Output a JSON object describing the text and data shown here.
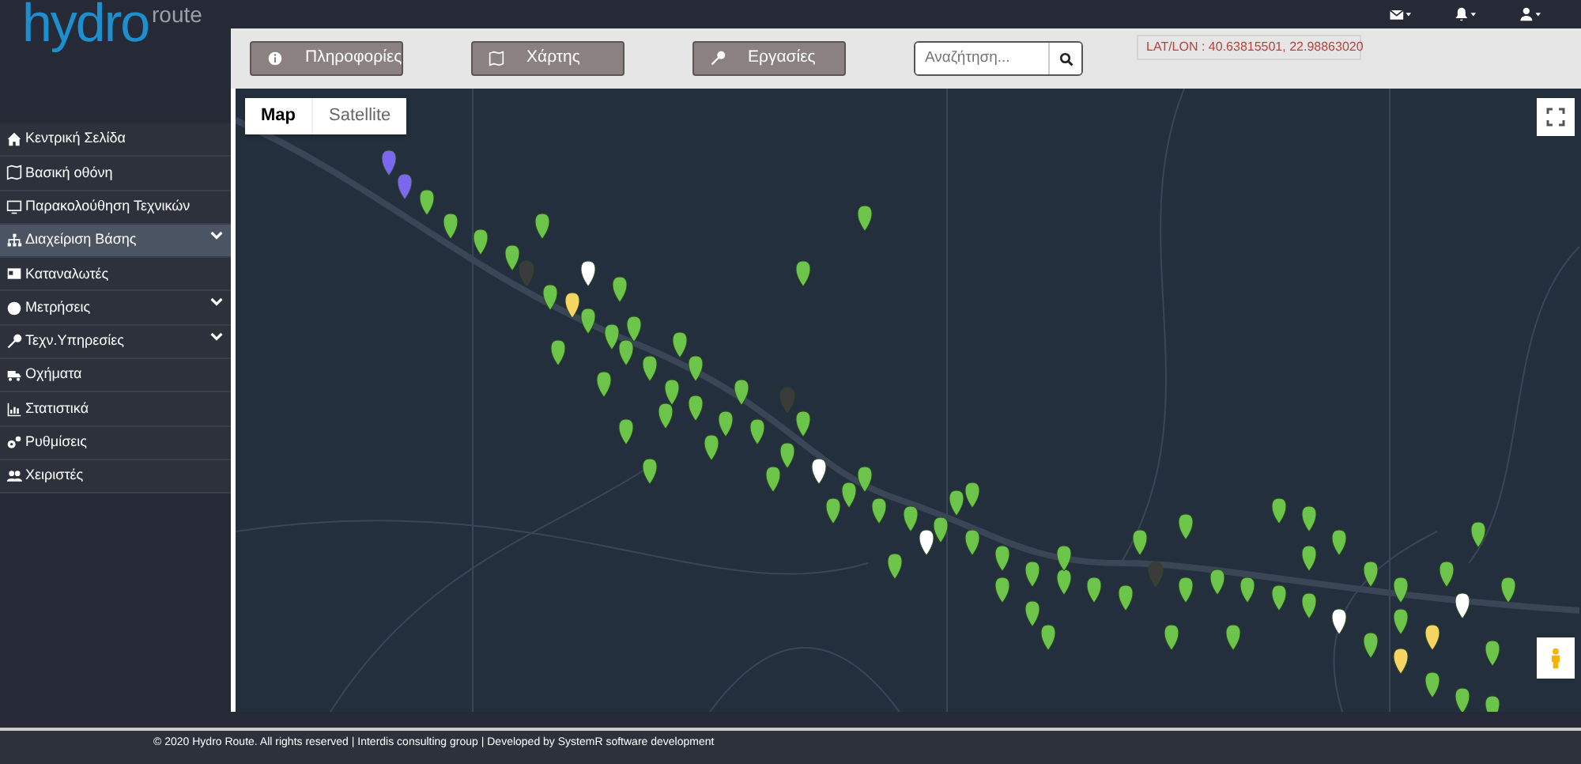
{
  "logo": {
    "main": "hydro",
    "sub": "route"
  },
  "sidebar": {
    "items": [
      {
        "label": "Κεντρική Σελίδα",
        "selected": false,
        "expandable": false
      },
      {
        "label": "Βασική οθόνη",
        "selected": false,
        "expandable": false
      },
      {
        "label": "Παρακολούθηση Τεχνικών",
        "selected": false,
        "expandable": false
      },
      {
        "label": "Διαχείριση Βάσης",
        "selected": true,
        "expandable": true
      },
      {
        "label": "Καταναλωτές",
        "selected": false,
        "expandable": false
      },
      {
        "label": "Μετρήσεις",
        "selected": false,
        "expandable": true
      },
      {
        "label": "Τεχν.Υπηρεσίες",
        "selected": false,
        "expandable": true
      },
      {
        "label": "Οχήματα",
        "selected": false,
        "expandable": false
      },
      {
        "label": "Στατιστικά",
        "selected": false,
        "expandable": false
      },
      {
        "label": "Ρυθμίσεις",
        "selected": false,
        "expandable": false
      },
      {
        "label": "Χειριστές",
        "selected": false,
        "expandable": false
      }
    ]
  },
  "toolbar": {
    "buttons": [
      {
        "label": "Πληροφορίες"
      },
      {
        "label": "Χάρτης"
      },
      {
        "label": "Εργασίες"
      }
    ],
    "search": {
      "placeholder": "Αναζήτηση..."
    },
    "coords": "LAT/LON : 40.63815501, 22.98863020"
  },
  "map": {
    "types": [
      {
        "label": "Map",
        "selected": true
      },
      {
        "label": "Satellite",
        "selected": false
      }
    ]
  },
  "footer": "© 2020 Hydro Route. All rights reserved | Interdis consulting group | Developed by SystemR software development"
}
